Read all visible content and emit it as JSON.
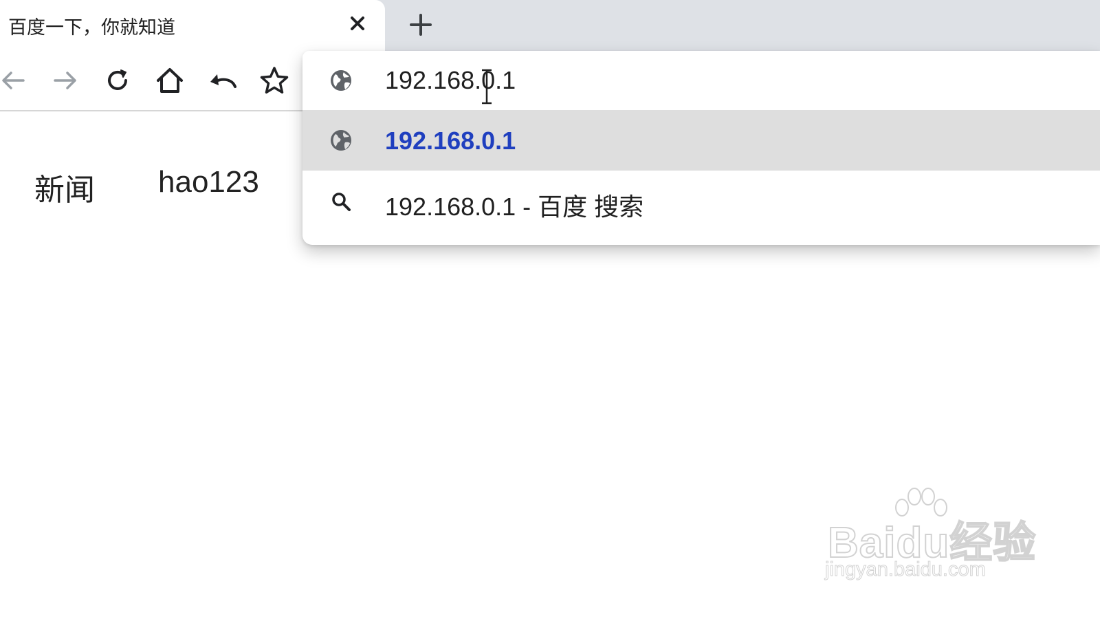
{
  "tab": {
    "title": "百度一下，你就知道"
  },
  "toolbar": {
    "buttons": [
      "back-icon",
      "forward-icon",
      "reload-icon",
      "home-icon",
      "undo-icon",
      "star-icon"
    ]
  },
  "page": {
    "links": [
      "新闻",
      "hao123"
    ]
  },
  "omnibox": {
    "input_value": "192.168.0.1",
    "suggestions": [
      {
        "type": "url",
        "icon": "globe-icon",
        "text": "192.168.0.1",
        "selected": true
      },
      {
        "type": "search",
        "icon": "search-icon",
        "text": "192.168.0.1 - 百度 搜索",
        "selected": false
      }
    ]
  },
  "watermark": {
    "logo": "Baidu经验",
    "url": "jingyan.baidu.com"
  },
  "colors": {
    "tabstrip_bg": "#dee1e6",
    "selected_suggestion_bg": "#dedede",
    "url_suggestion_text": "#1f3fbf",
    "icon_gray": "#5f6368"
  }
}
